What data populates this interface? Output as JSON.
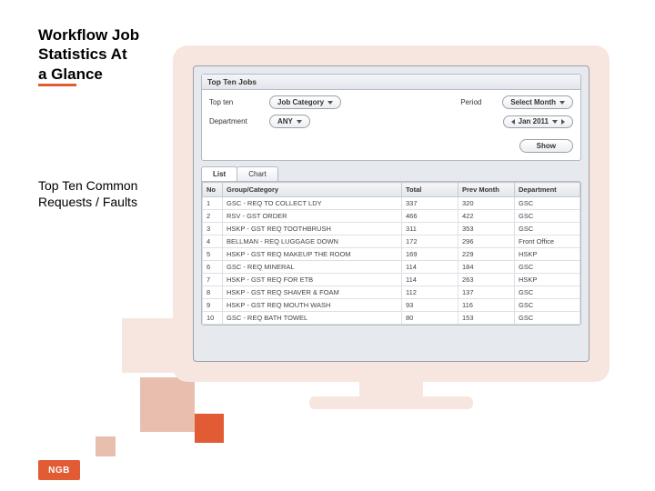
{
  "title_l1": "Workflow Job Statistics At",
  "title_l2a": "a Gla",
  "title_l2b": "nce",
  "subtitle": "Top Ten Common Requests / Faults",
  "logo": "NGB",
  "screen": {
    "heading": "Top Ten Jobs",
    "filters": {
      "topten_label": "Top ten",
      "topten_value": "Job Category",
      "period_label": "Period",
      "period_value": "Select Month",
      "dept_label": "Department",
      "dept_value": "ANY",
      "month_value": "Jan 2011",
      "show": "Show"
    },
    "tabs": {
      "list": "List",
      "chart": "Chart"
    },
    "columns": {
      "no": "No",
      "grp": "Group/Category",
      "total": "Total",
      "prev": "Prev Month",
      "dept": "Department"
    },
    "rows": [
      {
        "no": "1",
        "grp": "GSC - REQ TO COLLECT LDY",
        "total": "337",
        "prev": "320",
        "dept": "GSC"
      },
      {
        "no": "2",
        "grp": "RSV - GST ORDER",
        "total": "466",
        "prev": "422",
        "dept": "GSC"
      },
      {
        "no": "3",
        "grp": "HSKP - GST REQ TOOTHBRUSH",
        "total": "311",
        "prev": "353",
        "dept": "GSC"
      },
      {
        "no": "4",
        "grp": "BELLMAN - REQ LUGGAGE DOWN",
        "total": "172",
        "prev": "296",
        "dept": "Front Office"
      },
      {
        "no": "5",
        "grp": "HSKP - GST REQ MAKEUP THE ROOM",
        "total": "169",
        "prev": "229",
        "dept": "HSKP"
      },
      {
        "no": "6",
        "grp": "GSC - REQ MINERAL",
        "total": "114",
        "prev": "184",
        "dept": "GSC"
      },
      {
        "no": "7",
        "grp": "HSKP - GST REQ FOR ETB",
        "total": "114",
        "prev": "263",
        "dept": "HSKP"
      },
      {
        "no": "8",
        "grp": "HSKP - GST REQ SHAVER & FOAM",
        "total": "112",
        "prev": "137",
        "dept": "GSC"
      },
      {
        "no": "9",
        "grp": "HSKP - GST REQ MOUTH WASH",
        "total": "93",
        "prev": "116",
        "dept": "GSC"
      },
      {
        "no": "10",
        "grp": "GSC - REQ BATH TOWEL",
        "total": "80",
        "prev": "153",
        "dept": "GSC"
      }
    ]
  }
}
